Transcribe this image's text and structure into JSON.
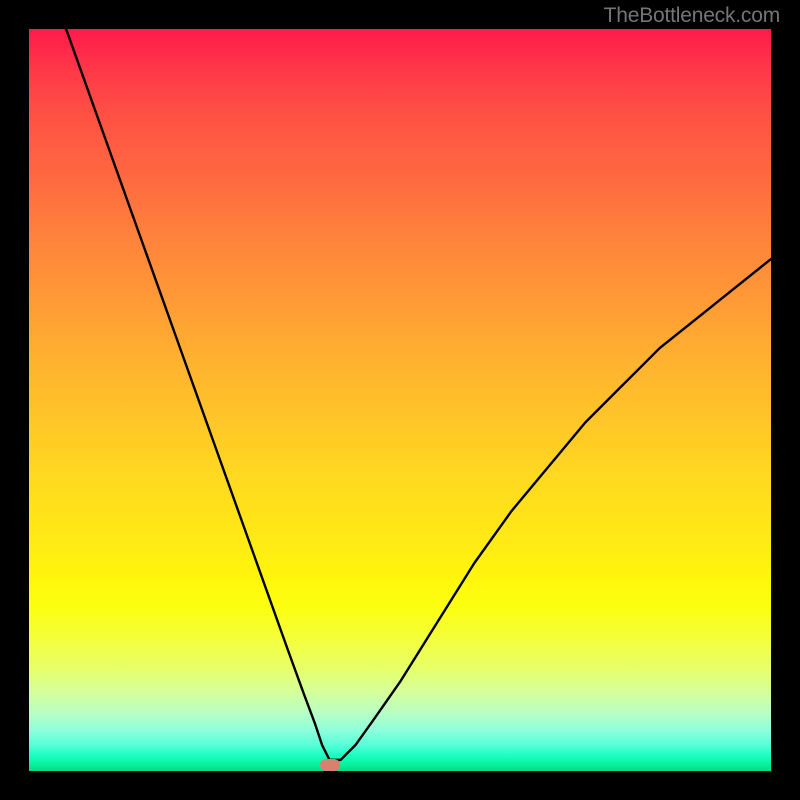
{
  "attribution": "TheBottleneck.com",
  "chart_data": {
    "type": "line",
    "title": "",
    "xlabel": "",
    "ylabel": "",
    "xlim": [
      0,
      100
    ],
    "ylim": [
      0,
      100
    ],
    "background_gradient": {
      "top_color": "#ff1a4a",
      "bottom_color": "#08d888",
      "meaning": "red=high bottleneck, green=low bottleneck"
    },
    "series": [
      {
        "name": "bottleneck-curve",
        "type": "line",
        "color": "#000000",
        "x": [
          5,
          7.5,
          10,
          12.5,
          15,
          17.5,
          20,
          22.5,
          25,
          27.5,
          30,
          32.5,
          35,
          37,
          38.5,
          39.5,
          40.5,
          42,
          44,
          46.5,
          50,
          55,
          60,
          65,
          70,
          75,
          80,
          85,
          90,
          95,
          100
        ],
        "y": [
          100,
          93,
          86,
          79,
          72,
          65,
          58,
          51,
          44,
          37,
          30,
          23,
          16,
          10.5,
          6.5,
          3.5,
          1.5,
          1.5,
          3.5,
          7,
          12,
          20,
          28,
          35,
          41,
          47,
          52,
          57,
          61,
          65,
          69
        ]
      }
    ],
    "marker": {
      "name": "optimal-point",
      "x": 40.5,
      "y": 0.8,
      "color": "#d8816f",
      "shape": "rounded-rect"
    }
  }
}
